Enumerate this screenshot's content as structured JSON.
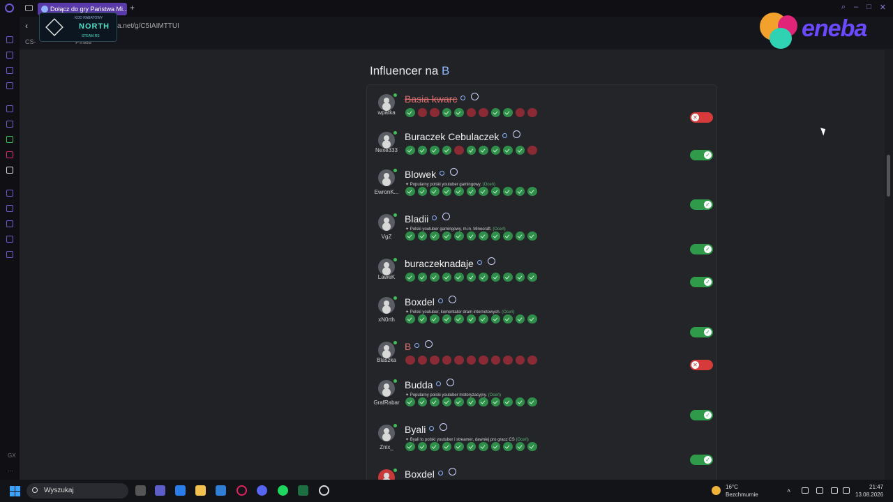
{
  "browser": {
    "tab_title": "Dołącz do gry Państwa Mi...",
    "url": "a.net/g/C5IAIMTTUI",
    "bookmarks": [
      "CS-",
      "Pirate"
    ],
    "ad_north": {
      "top": "KOD RABATOWY",
      "name": "NORTH",
      "sub": "STEAM.RS"
    },
    "ad_eneba": {
      "text": "eneba"
    }
  },
  "section": {
    "title_prefix": "Influencer na ",
    "letter": "B"
  },
  "rows": [
    {
      "user": "wpatka",
      "name": "Basia kwarc",
      "name_style": "struck",
      "desc": "",
      "rate": "",
      "dots": [
        "ok",
        "bad",
        "bad",
        "ok",
        "ok",
        "bad",
        "bad",
        "ok",
        "ok",
        "bad",
        "bad"
      ],
      "enabled": false
    },
    {
      "user": "Nexe333",
      "name": "Buraczek Cebulaczek",
      "name_style": "normal",
      "desc": "",
      "rate": "",
      "dots": [
        "ok",
        "ok",
        "ok",
        "ok",
        "bad",
        "ok",
        "ok",
        "ok",
        "ok",
        "ok",
        "bad"
      ],
      "enabled": true
    },
    {
      "user": "EwronK...",
      "name": "Blowek",
      "name_style": "normal",
      "desc": "Popularny polski youtuber gamingowy.",
      "rate": "(Oceń)",
      "dots": [
        "ok",
        "ok",
        "ok",
        "ok",
        "ok",
        "ok",
        "ok",
        "ok",
        "ok",
        "ok",
        "ok"
      ],
      "enabled": true
    },
    {
      "user": "VgZ",
      "name": "Bladii",
      "name_style": "normal",
      "desc": "Polski youtuber gamingowy, m.in. Minecraft.",
      "rate": "(Oceń)",
      "dots": [
        "ok",
        "ok",
        "ok",
        "ok",
        "ok",
        "ok",
        "ok",
        "ok",
        "ok",
        "ok",
        "ok"
      ],
      "enabled": true
    },
    {
      "user": "LaweK",
      "name": "buraczeknadaje",
      "name_style": "normal",
      "desc": "",
      "rate": "",
      "dots": [
        "ok",
        "ok",
        "ok",
        "ok",
        "ok",
        "ok",
        "ok",
        "ok",
        "ok",
        "ok",
        "ok"
      ],
      "enabled": true
    },
    {
      "user": "xN0rth",
      "name": "Boxdel",
      "name_style": "normal",
      "desc": "Polski youtuber, komentator dram internetowych.",
      "rate": "(Oceń)",
      "dots": [
        "ok",
        "ok",
        "ok",
        "ok",
        "ok",
        "ok",
        "ok",
        "ok",
        "ok",
        "ok",
        "ok"
      ],
      "enabled": true
    },
    {
      "user": "Blaszka",
      "name": "B",
      "name_style": "red",
      "desc": "",
      "rate": "",
      "dots": [
        "bad",
        "bad",
        "bad",
        "bad",
        "bad",
        "bad",
        "bad",
        "bad",
        "bad",
        "bad",
        "bad"
      ],
      "enabled": false
    },
    {
      "user": "GrafRabar",
      "name": "Budda",
      "name_style": "normal",
      "desc": "Popularny polski youtuber motoryzacyjny.",
      "rate": "(Oceń)",
      "dots": [
        "ok",
        "ok",
        "ok",
        "ok",
        "ok",
        "ok",
        "ok",
        "ok",
        "ok",
        "ok",
        "ok"
      ],
      "enabled": true
    },
    {
      "user": "Znix_",
      "name": "Byali",
      "name_style": "normal",
      "desc": "Byali to polski youtuber i streamer, dawniej pro gracz CS",
      "rate": "(Oceń)",
      "dots": [
        "ok",
        "ok",
        "ok",
        "ok",
        "ok",
        "ok",
        "ok",
        "ok",
        "ok",
        "ok",
        "ok"
      ],
      "enabled": true
    },
    {
      "user": "",
      "name": "Boxdel",
      "name_style": "normal",
      "desc": "",
      "rate": "",
      "dots": [],
      "enabled": true
    }
  ],
  "taskbar": {
    "search_placeholder": "Wyszukaj",
    "temp": "16°C",
    "weather": "Bezchmurnie",
    "time": "21:47",
    "date": "13.08.2026"
  },
  "colors": {
    "accent": "#6b5bd6",
    "ok": "#2f8f4a",
    "bad": "#8a2a35",
    "toggle_on": "#2f9a4a",
    "toggle_off": "#d63a3a"
  }
}
